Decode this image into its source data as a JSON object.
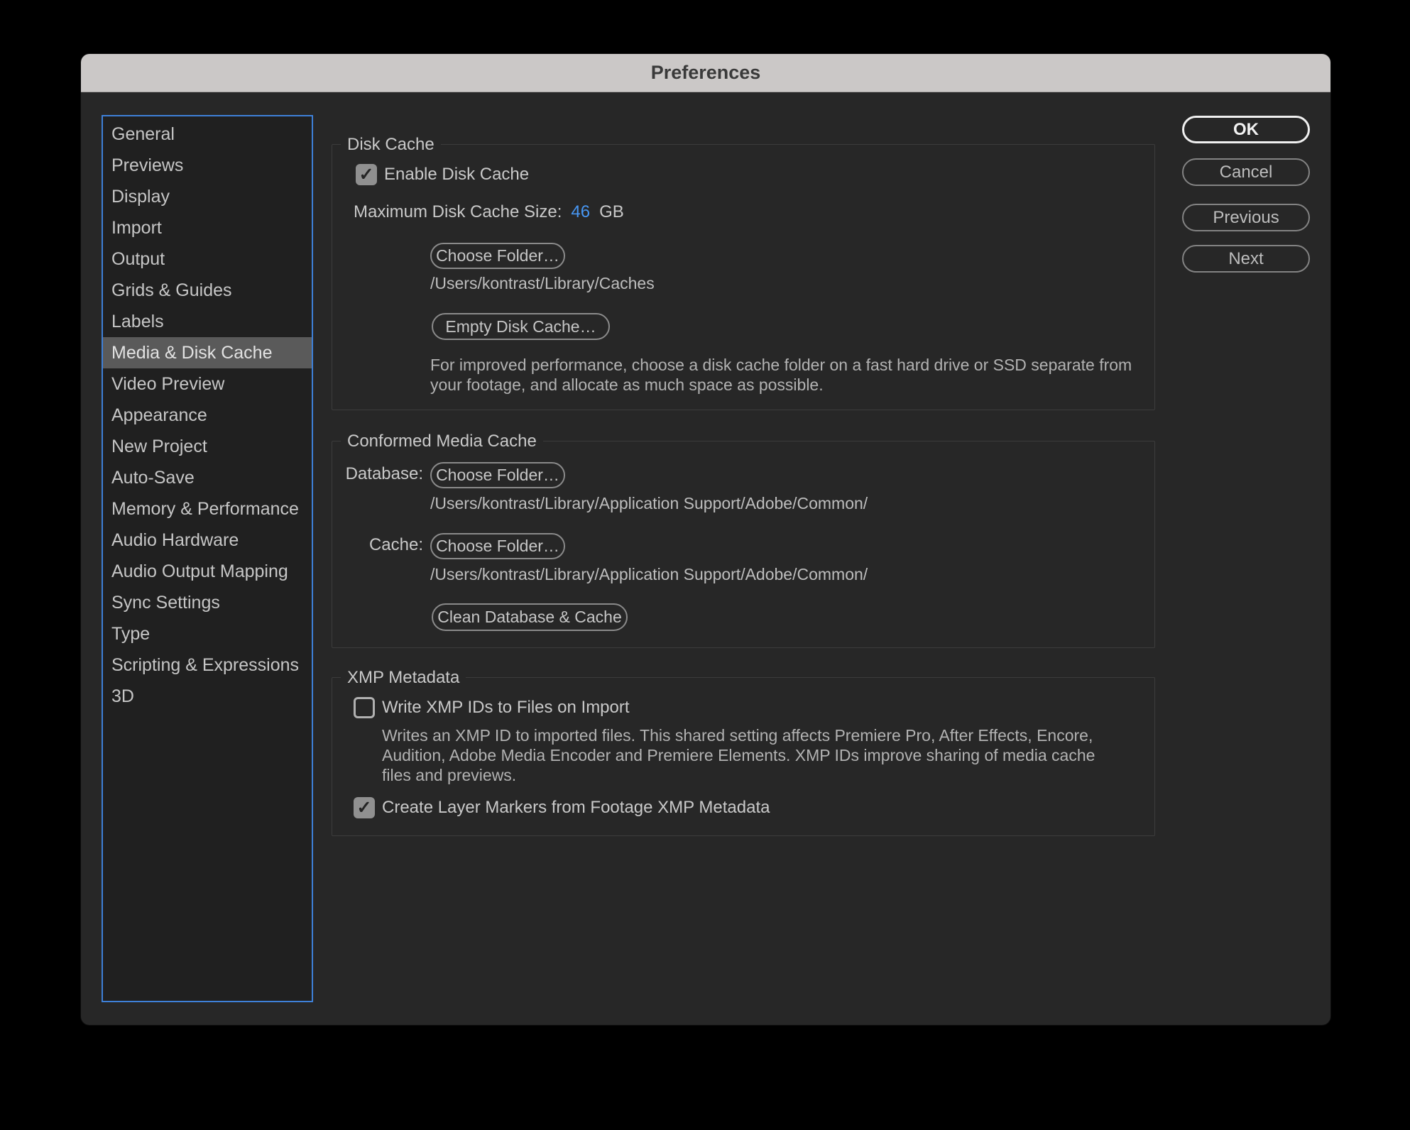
{
  "window": {
    "title": "Preferences"
  },
  "sidebar": {
    "items": [
      {
        "label": "General",
        "selected": false
      },
      {
        "label": "Previews",
        "selected": false
      },
      {
        "label": "Display",
        "selected": false
      },
      {
        "label": "Import",
        "selected": false
      },
      {
        "label": "Output",
        "selected": false
      },
      {
        "label": "Grids & Guides",
        "selected": false
      },
      {
        "label": "Labels",
        "selected": false
      },
      {
        "label": "Media & Disk Cache",
        "selected": true
      },
      {
        "label": "Video Preview",
        "selected": false
      },
      {
        "label": "Appearance",
        "selected": false
      },
      {
        "label": "New Project",
        "selected": false
      },
      {
        "label": "Auto-Save",
        "selected": false
      },
      {
        "label": "Memory & Performance",
        "selected": false
      },
      {
        "label": "Audio Hardware",
        "selected": false
      },
      {
        "label": "Audio Output Mapping",
        "selected": false
      },
      {
        "label": "Sync Settings",
        "selected": false
      },
      {
        "label": "Type",
        "selected": false
      },
      {
        "label": "Scripting & Expressions",
        "selected": false
      },
      {
        "label": "3D",
        "selected": false
      }
    ]
  },
  "actions": {
    "ok": "OK",
    "cancel": "Cancel",
    "previous": "Previous",
    "next": "Next"
  },
  "disk_cache": {
    "legend": "Disk Cache",
    "enable_label": "Enable Disk Cache",
    "enable_checked": true,
    "max_size_label": "Maximum Disk Cache Size:",
    "max_size_value": "46",
    "max_size_unit": "GB",
    "choose_folder_label": "Choose Folder…",
    "folder_path": "/Users/kontrast/Library/Caches",
    "empty_button_label": "Empty Disk Cache…",
    "description": "For improved performance, choose a disk cache folder on a fast hard drive or SSD separate from your footage, and allocate as much space as possible."
  },
  "conformed_media_cache": {
    "legend": "Conformed Media Cache",
    "database_label": "Database:",
    "database_button": "Choose Folder…",
    "database_path": "/Users/kontrast/Library/Application Support/Adobe/Common/",
    "cache_label": "Cache:",
    "cache_button": "Choose Folder…",
    "cache_path": "/Users/kontrast/Library/Application Support/Adobe/Common/",
    "clean_button": "Clean Database & Cache"
  },
  "xmp_metadata": {
    "legend": "XMP Metadata",
    "write_label": "Write XMP IDs to Files on Import",
    "write_checked": false,
    "write_description": "Writes an XMP ID to imported files. This shared setting affects Premiere Pro, After Effects, Encore, Audition, Adobe Media Encoder and Premiere Elements. XMP IDs improve sharing of media cache files and previews.",
    "markers_label": "Create Layer Markers from Footage XMP Metadata",
    "markers_checked": true
  },
  "icons": {
    "checkmark": "✓"
  },
  "colors": {
    "accent_blue": "#4796F2",
    "sidebar_focus_border": "#3E80D8",
    "selection_gray": "#5A5A5A",
    "titlebar": "#CBC8C7",
    "dialog_bg": "#272727"
  }
}
